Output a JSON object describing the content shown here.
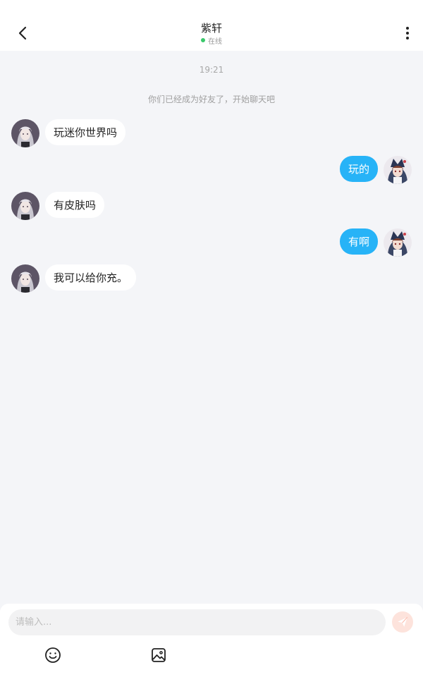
{
  "header": {
    "title": "紫轩",
    "status": "在线",
    "status_color": "#3ac86b"
  },
  "chat": {
    "time": "19:21",
    "system_note": "你们已经成为好友了，开始聊天吧",
    "messages": [
      {
        "side": "left",
        "text": "玩迷你世界吗"
      },
      {
        "side": "right",
        "text": "玩的"
      },
      {
        "side": "left",
        "text": "有皮肤吗"
      },
      {
        "side": "right",
        "text": "有啊"
      },
      {
        "side": "left",
        "text": "我可以给你充。"
      }
    ]
  },
  "composer": {
    "placeholder": "请输入...",
    "value": ""
  },
  "colors": {
    "outgoing_bubble": "#27b3f7",
    "incoming_bubble": "#ffffff",
    "background": "#f4f5f8",
    "send_button": "#f7a08c"
  },
  "icons": {
    "back": "chevron-left-icon",
    "more": "more-vertical-icon",
    "send": "paper-plane-icon",
    "emoji": "smiley-icon",
    "image": "image-icon"
  }
}
